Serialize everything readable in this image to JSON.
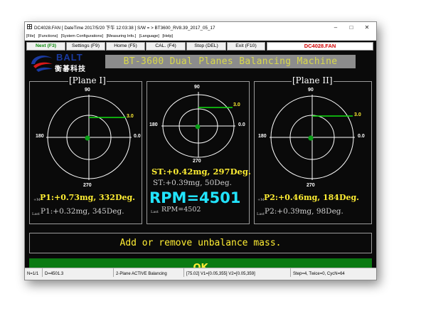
{
  "window": {
    "title": "DC4028.FAN  [ DateTime 2017/5/20 下午 12:03:38 ] S/W = > BT3600_RV8.39_2017_05_17"
  },
  "menu": [
    "[File]",
    "[Functions]",
    "[System Configurations]",
    "[Measuring Info.]",
    "[Language]",
    "[Help]"
  ],
  "toolbar": {
    "buttons": [
      "Next (F3)",
      "Settings (F9)",
      "Home (F5)",
      "CAL. (F4)",
      "Stop (DEL)",
      "Exit (F10)"
    ],
    "file_name": "DC4028.FAN"
  },
  "logo": {
    "brand": "BALT",
    "chinese": "衡碁科技"
  },
  "banner": "BT-3600 Dual Planes Balancing Machine",
  "polar_labels": {
    "top": "90",
    "left": "180",
    "right": "0.0",
    "bottom": "270"
  },
  "plane1": {
    "title": "[Plane I]",
    "scale": "3.0",
    "now_prefix": "+M",
    "now": "P1:+0.73mg, 332Deg.",
    "last_prefix": "Last",
    "last": "P1:+0.32mg, 345Deg."
  },
  "static": {
    "scale": "3.0",
    "st": "ST:+0.42mg, 297Deg.",
    "st_second": "ST:+0.39mg, 50Deg.",
    "rpm": "RPM=4501",
    "last_prefix": "Last",
    "last_rpm": "RPM=4502"
  },
  "plane2": {
    "title": "[Plane II]",
    "scale": "3.0",
    "now_prefix": "+M",
    "now": "P2:+0.46mg, 184Deg.",
    "last_prefix": "Last",
    "last": "P2:+0.39mg, 98Deg."
  },
  "message": "Add or remove unbalance mass.",
  "ok_label": "OK",
  "status": {
    "n": "N=1/1",
    "d": "D=4501.3",
    "mode": "2-Plane ACTIVE Balancing",
    "vectors": "[75.02] V1=[0.05,355] V2=[0.05,359]",
    "step": "Step=4, Twice=0, CycN=64"
  },
  "colors": {
    "accent_green": "#0a7a12",
    "text_yellow": "#ffee33",
    "rpm_cyan": "#22e4ff",
    "file_red": "#d00000",
    "banner_gray": "#8c8c8c"
  }
}
